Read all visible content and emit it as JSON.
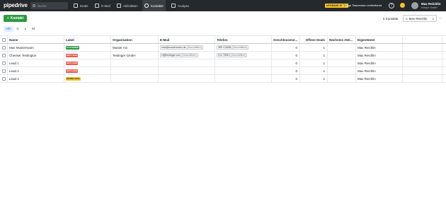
{
  "app": {
    "logo": "pipedrive"
  },
  "search": {
    "placeholder": "Suche"
  },
  "nav": [
    {
      "label": "Deals"
    },
    {
      "label": "E-Mail"
    },
    {
      "label": "Aktivitäten"
    },
    {
      "label": "Kontakte"
    },
    {
      "label": "Analyse"
    }
  ],
  "trial": {
    "badge": "UPGRADE JETZT",
    "text": "14 Tage Testversion verbleibend"
  },
  "help": {
    "glyph": "?"
  },
  "user": {
    "name": "Max Reichlin",
    "company": "Invasor GmbH"
  },
  "toolbar": {
    "add_label": "Kontakt",
    "count": "5 Kontakte",
    "owner_filter": "Max Reichlin",
    "more": "..."
  },
  "letters": [
    "Alle",
    "C",
    "L",
    "M"
  ],
  "table": {
    "columns": {
      "name": "Name",
      "label": "Label",
      "org": "Organisation",
      "email": "E-Mail",
      "phone": "Telefon",
      "closed": "Geschlossene...",
      "open": "Offene Deals",
      "next": "Nächstes Akti...",
      "owner": "Eigentümer"
    },
    "rows": [
      {
        "name": "Max Mustermann",
        "label": "CUSTOMER",
        "org": "Muster AG",
        "email": "max@mustermann.de",
        "email_type": "(Geschäftlich)",
        "phone": "089 123456",
        "phone_type": "(Geschäftlich)",
        "closed": "0",
        "open": "1",
        "next": "",
        "owner": "Max Reichlin"
      },
      {
        "name": "Checker Testington",
        "label": "HOT LEAD",
        "org": "Testinger GmbH",
        "email": "ct@testinger.com",
        "email_type": "(Geschäftlich)",
        "phone": "012 78910",
        "phone_type": "(Geschäftlich)",
        "closed": "0",
        "open": "1",
        "next": "",
        "owner": "Max Reichlin"
      },
      {
        "name": "Lead 1",
        "label": "HOT LEAD",
        "org": "",
        "email": "",
        "email_type": "",
        "phone": "",
        "phone_type": "",
        "closed": "0",
        "open": "1",
        "next": "",
        "owner": "Max Reichlin"
      },
      {
        "name": "Lead 2",
        "label": "HOT LEAD",
        "org": "",
        "email": "",
        "email_type": "",
        "phone": "",
        "phone_type": "",
        "closed": "0",
        "open": "1",
        "next": "",
        "owner": "Max Reichlin"
      },
      {
        "name": "Lead 3",
        "label": "WARM LEAD",
        "org": "",
        "email": "",
        "email_type": "",
        "phone": "",
        "phone_type": "",
        "closed": "0",
        "open": "1",
        "next": "",
        "owner": "Max Reichlin"
      }
    ]
  },
  "colors": {
    "topbar": "#26292c",
    "primary_green": "#2a9b3f",
    "customer_badge": "#2a9b3f",
    "hot_lead_badge": "#e45d50",
    "warm_lead_badge": "#f7c325",
    "trial_badge": "#f7c325"
  }
}
